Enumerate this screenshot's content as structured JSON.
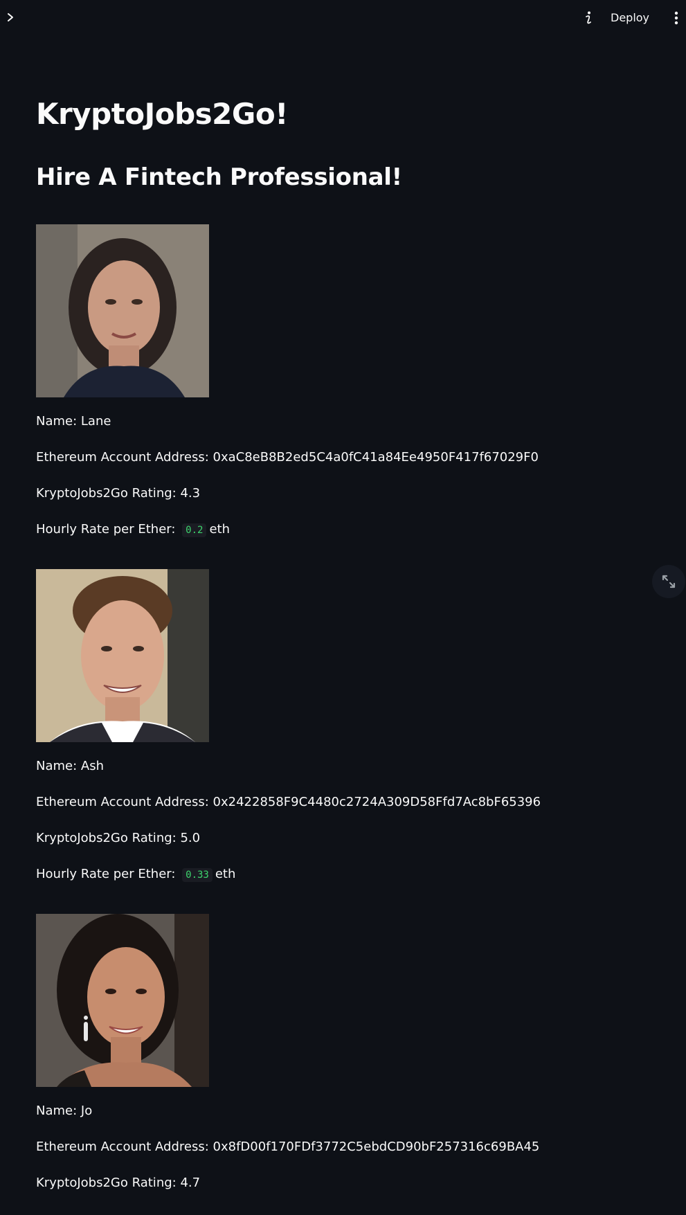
{
  "header": {
    "deploy_label": "Deploy",
    "icons": {
      "sidebar_toggle": "chevron-right-icon",
      "info": "info-icon",
      "menu": "more-vertical-icon",
      "expand": "expand-icon"
    }
  },
  "page": {
    "title": "KryptoJobs2Go!",
    "subtitle": "Hire A Fintech Professional!"
  },
  "labels": {
    "name_prefix": "Name: ",
    "address_prefix": "Ethereum Account Address: ",
    "rating_prefix": "KryptoJobs2Go Rating: ",
    "rate_prefix": "Hourly Rate per Ether: ",
    "rate_unit": "eth"
  },
  "candidates": [
    {
      "name": "Lane",
      "address": "0xaC8eB8B2ed5C4a0fC41a84Ee4950F417f67029F0",
      "rating": "4.3",
      "rate": "0.2"
    },
    {
      "name": "Ash",
      "address": "0x2422858F9C4480c2724A309D58Ffd7Ac8bF65396",
      "rating": "5.0",
      "rate": "0.33"
    },
    {
      "name": "Jo",
      "address": "0x8fD00f170FDf3772C5ebdCD90bF257316c69BA45",
      "rating": "4.7",
      "rate": ""
    }
  ],
  "colors": {
    "background": "#0e1117",
    "text": "#fafafa",
    "code_text": "#3dd56d",
    "code_background": "#1a1c23"
  }
}
